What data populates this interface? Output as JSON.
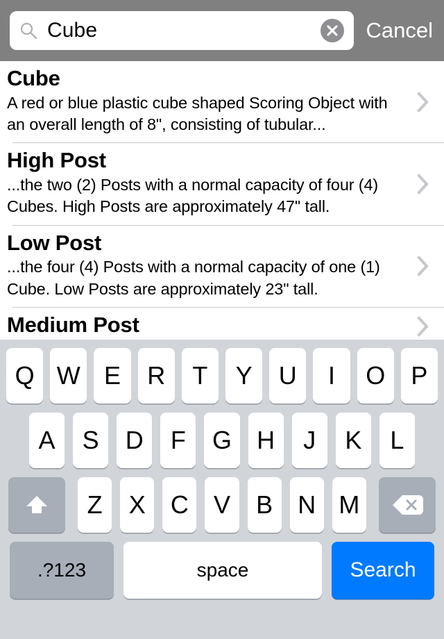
{
  "search": {
    "value": "Cube",
    "placeholder": "Search",
    "cancel_label": "Cancel",
    "icons": {
      "magnifier": "search-icon",
      "clear": "clear-icon"
    },
    "colors": {
      "bar_background": "#808080",
      "field_background": "#ffffff",
      "clear_button": "#8e8e93"
    }
  },
  "results": [
    {
      "title": "Cube",
      "description": "A red or blue plastic cube shaped Scoring Object with an overall length of 8\", consisting of tubular..."
    },
    {
      "title": "High Post",
      "description": "...the two (2) Posts with a normal capacity of four (4) Cubes. High Posts are approximately 47\" tall."
    },
    {
      "title": "Low Post",
      "description": "...the four (4) Posts with a normal capacity of one (1) Cube. Low Posts are approximately 23\" tall."
    },
    {
      "title": "Medium Post",
      "description": ""
    }
  ],
  "keyboard": {
    "row1": [
      "Q",
      "W",
      "E",
      "R",
      "T",
      "Y",
      "U",
      "I",
      "O",
      "P"
    ],
    "row2": [
      "A",
      "S",
      "D",
      "F",
      "G",
      "H",
      "J",
      "K",
      "L"
    ],
    "row3": [
      "Z",
      "X",
      "C",
      "V",
      "B",
      "N",
      "M"
    ],
    "shift_icon": "shift-icon",
    "backspace_icon": "backspace-icon",
    "numeric_label": ".?123",
    "space_label": "space",
    "search_label": "Search",
    "colors": {
      "background": "#d1d5da",
      "key": "#ffffff",
      "function_key": "#a8aeb8",
      "search_key": "#007aff"
    }
  }
}
